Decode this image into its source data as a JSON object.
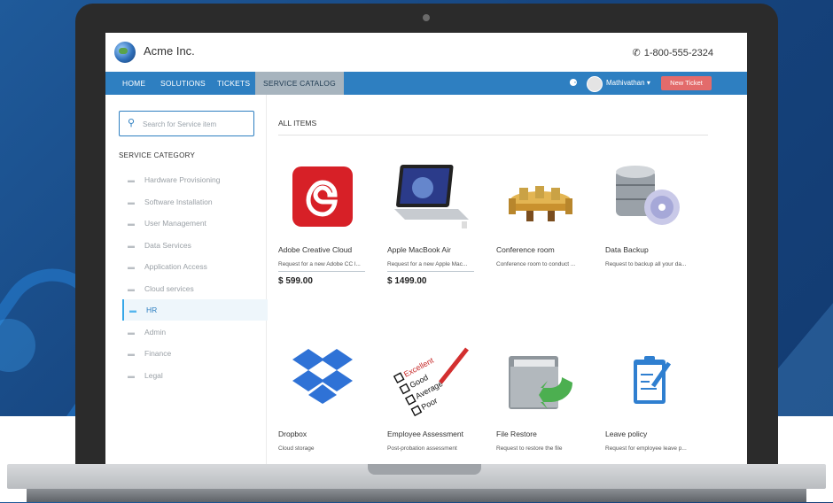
{
  "header": {
    "brand": "Acme Inc.",
    "phone": "1-800-555-2324",
    "phone_icon": "phone-icon",
    "logo_icon": "globe-logo-icon"
  },
  "nav": {
    "items": [
      {
        "label": "HOME"
      },
      {
        "label": "SOLUTIONS"
      },
      {
        "label": "TICKETS"
      },
      {
        "label": "SERVICE CATALOG",
        "active": true
      }
    ],
    "user": "Mathivathan",
    "new_ticket": "New Ticket",
    "colors": {
      "nav_bg": "#2e7fc1",
      "active_bg": "#a7b4be",
      "new_ticket_bg": "#e36b6b"
    }
  },
  "sidebar": {
    "search_placeholder": "Search for Service item",
    "category_title": "SERVICE CATEGORY",
    "items": [
      {
        "label": "Hardware Provisioning"
      },
      {
        "label": "Software Installation"
      },
      {
        "label": "User Management"
      },
      {
        "label": "Data Services"
      },
      {
        "label": "Application Access"
      },
      {
        "label": "Cloud services"
      },
      {
        "label": "HR",
        "active": true
      },
      {
        "label": "Admin"
      },
      {
        "label": "Finance"
      },
      {
        "label": "Legal"
      }
    ]
  },
  "main": {
    "heading": "ALL ITEMS",
    "items": [
      {
        "name": "Adobe Creative Cloud",
        "desc": "Request for a new Adobe CC l...",
        "price": "$ 599.00",
        "icon": "adobe-cc-icon"
      },
      {
        "name": "Apple MacBook Air",
        "desc": "Request for a new Apple Mac...",
        "price": "$ 1499.00",
        "icon": "macbook-icon"
      },
      {
        "name": "Conference room",
        "desc": "Conference room to conduct ...",
        "price": "",
        "icon": "conference-room-icon"
      },
      {
        "name": "Data Backup",
        "desc": "Request to backup all your da...",
        "price": "",
        "icon": "data-backup-icon"
      },
      {
        "name": "Dropbox",
        "desc": "Cloud storage",
        "price": "",
        "icon": "dropbox-icon"
      },
      {
        "name": "Employee Assessment",
        "desc": "Post-probation assessment",
        "price": "",
        "icon": "assessment-icon"
      },
      {
        "name": "File Restore",
        "desc": "Request to restore the file",
        "price": "",
        "icon": "file-restore-icon"
      },
      {
        "name": "Leave policy",
        "desc": "Request for employee leave p...",
        "price": "",
        "icon": "leave-policy-icon"
      }
    ],
    "assessment_words": [
      "Excellent",
      "Good",
      "Average",
      "Poor"
    ]
  }
}
